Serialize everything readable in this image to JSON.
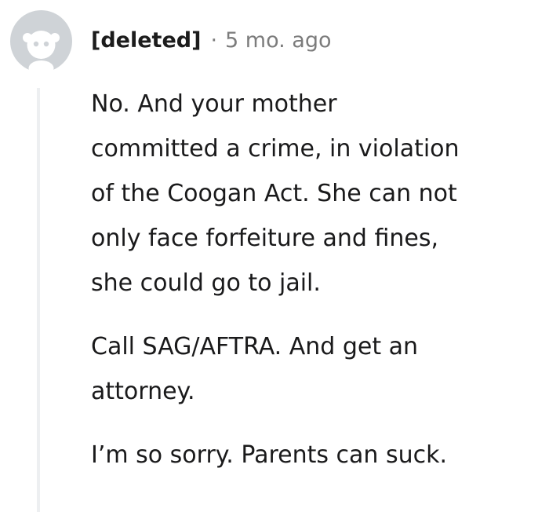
{
  "comment": {
    "author": "[deleted]",
    "separator": "·",
    "time": "5 mo. ago",
    "avatar_icon": "reddit-snoo-avatar-icon",
    "paragraphs": [
      [
        "No. And your mother",
        "committed a crime, in violation",
        "of the Coogan Act. She can not",
        "only face forfeiture and fines,",
        "she could go to jail."
      ],
      [
        "Call SAG/AFTRA. And get an",
        "attorney."
      ],
      [
        "I’m so sorry. Parents can suck."
      ]
    ]
  },
  "colors": {
    "avatar_gray": "#cfd3d7",
    "meta_gray": "#7c7c7c",
    "thread_line": "#edeff1",
    "text": "#1a1a1b"
  }
}
